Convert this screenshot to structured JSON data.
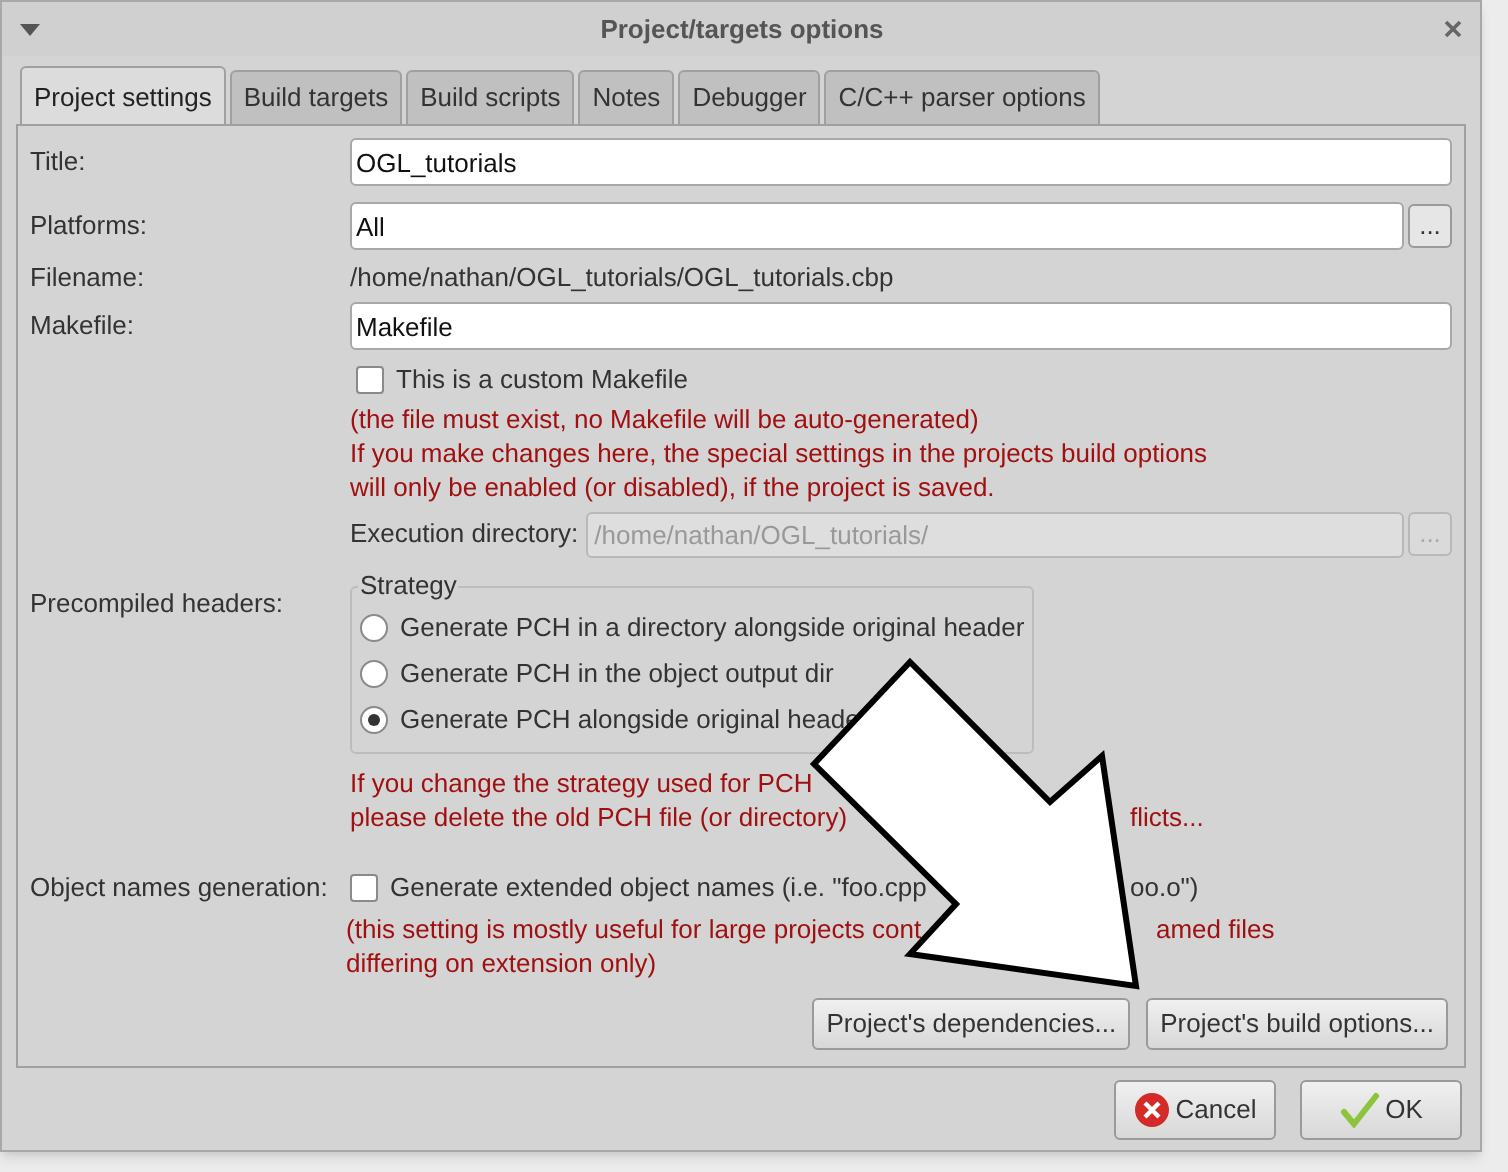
{
  "window": {
    "title": "Project/targets options"
  },
  "tabs": [
    {
      "label": "Project settings",
      "selected": true
    },
    {
      "label": "Build targets",
      "selected": false
    },
    {
      "label": "Build scripts",
      "selected": false
    },
    {
      "label": "Notes",
      "selected": false
    },
    {
      "label": "Debugger",
      "selected": false
    },
    {
      "label": "C/C++ parser options",
      "selected": false
    }
  ],
  "title_field": {
    "label": "Title:",
    "value": "OGL_tutorials"
  },
  "platforms": {
    "label": "Platforms:",
    "value": "All",
    "button": "..."
  },
  "filename": {
    "label": "Filename:",
    "value": "/home/nathan/OGL_tutorials/OGL_tutorials.cbp"
  },
  "makefile": {
    "label": "Makefile:",
    "value": "Makefile"
  },
  "custom_makefile": {
    "label": "This is a custom Makefile",
    "checked": false
  },
  "makefile_notes": [
    "(the file must exist, no Makefile will be auto-generated)",
    "If you make changes here, the special settings in the projects build options",
    "will only be enabled (or disabled), if the project is saved."
  ],
  "execution_directory": {
    "label": "Execution directory:",
    "value": "/home/nathan/OGL_tutorials/",
    "disabled": true,
    "button": "..."
  },
  "precompiled_headers": {
    "label": "Precompiled headers:",
    "group_title": "Strategy",
    "options": [
      {
        "label": "Generate PCH in a directory alongside original header",
        "selected": false
      },
      {
        "label": "Generate PCH in the object output dir",
        "selected": false
      },
      {
        "label": "Generate PCH alongside original heade",
        "selected": true
      }
    ],
    "notes": [
      {
        "parts": [
          "If you change the strategy used for PCH"
        ]
      },
      {
        "parts": [
          "please delete the old PCH file (or directory)",
          "flicts..."
        ]
      }
    ]
  },
  "object_names": {
    "label": "Object names generation:",
    "checkbox_parts": [
      "Generate extended object names (i.e. \"foo.cpp",
      "oo.o\")"
    ],
    "checked": false,
    "notes": [
      {
        "parts": [
          "(this setting is mostly useful for large projects cont",
          "amed files"
        ]
      },
      {
        "parts": [
          "differing on extension only)"
        ]
      }
    ]
  },
  "buttons": [
    "Project's dependencies...",
    "Project's build options..."
  ],
  "dialog_buttons": [
    {
      "kind": "cancel",
      "label": "Cancel"
    },
    {
      "kind": "ok",
      "label": "OK"
    }
  ]
}
